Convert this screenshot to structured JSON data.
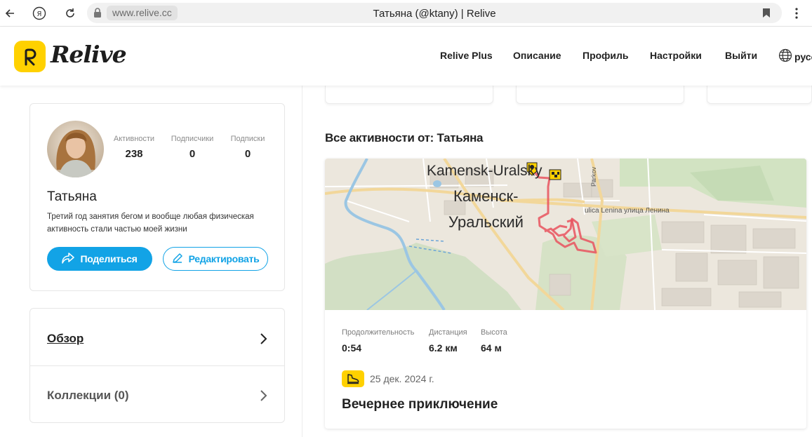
{
  "browser": {
    "url": "www.relive.cc",
    "tab_title": "Татьяна (@ktany) | Relive"
  },
  "header": {
    "logo_text": "Relive",
    "nav": [
      "Relive Plus",
      "Описание",
      "Профиль",
      "Настройки",
      "Выйти"
    ],
    "lang": "русс"
  },
  "profile": {
    "stats": [
      {
        "label": "Активности",
        "value": "238"
      },
      {
        "label": "Подписчики",
        "value": "0"
      },
      {
        "label": "Подписки",
        "value": "0"
      }
    ],
    "name": "Татьяна",
    "bio": "Третий год занятия бегом и вообще любая физическая активность стали частью моей жизни",
    "share_label": "Поделиться",
    "edit_label": "Редактировать"
  },
  "menu": {
    "overview": "Обзор",
    "collections": "Коллекции (0)"
  },
  "activities": {
    "section_title": "Все активности от: Татьяна",
    "map": {
      "city_en": "Kamensk-Uralsky",
      "city_ru_1": "Каменск-",
      "city_ru_2": "Уральский",
      "street": "ulica Lenina улица Ленина",
      "street2": "Parkov"
    },
    "metrics": [
      {
        "label": "Продолжительность",
        "value": "0:54"
      },
      {
        "label": "Дистанция",
        "value": "6.2 км"
      },
      {
        "label": "Высота",
        "value": "64 м"
      }
    ],
    "date": "25 дек. 2024 г.",
    "title": "Вечернее приключение"
  },
  "colors": {
    "brand_yellow": "#ffd100",
    "accent_blue": "#12a3e6",
    "route_red": "#e9525e"
  }
}
